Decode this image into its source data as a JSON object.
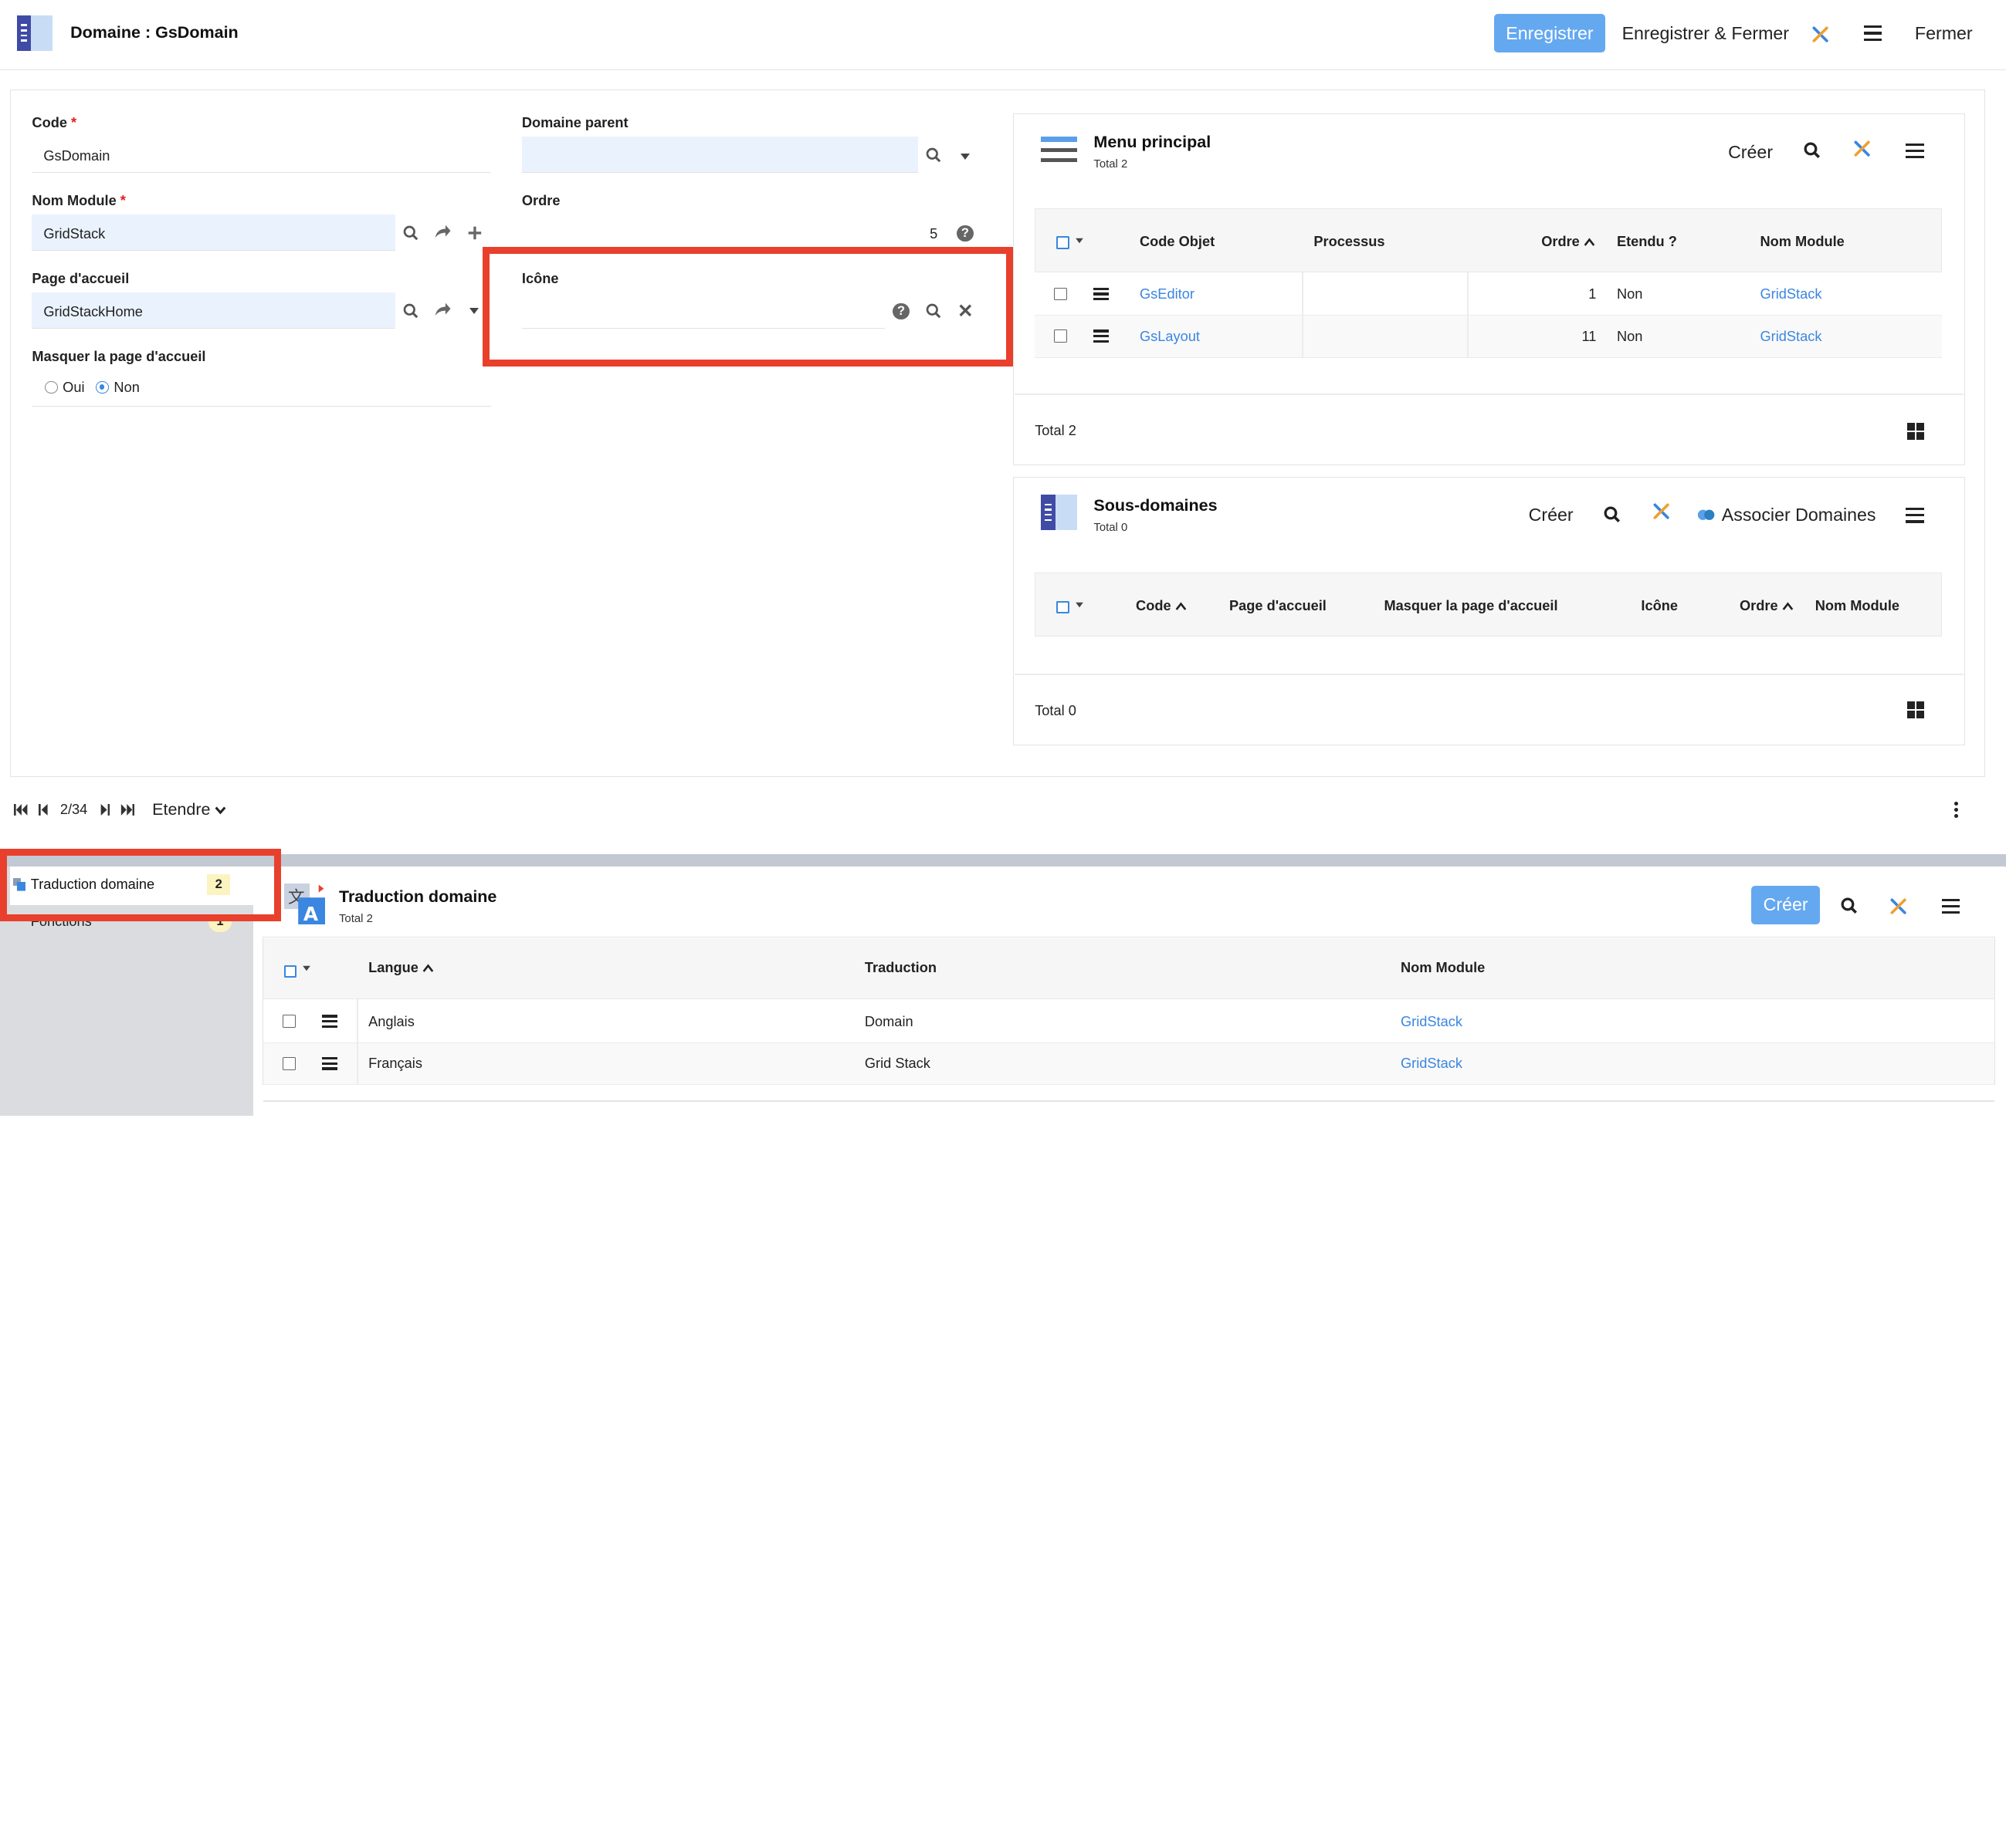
{
  "header": {
    "title": "Domaine : GsDomain",
    "save_label": "Enregistrer",
    "save_close_label": "Enregistrer & Fermer",
    "close_label": "Fermer"
  },
  "form": {
    "code_label": "Code",
    "code_value": "GsDomain",
    "module_label": "Nom Module",
    "module_value": "GridStack",
    "home_label": "Page d'accueil",
    "home_value": "GridStackHome",
    "hide_home_label": "Masquer la page d'accueil",
    "radio_oui": "Oui",
    "radio_non": "Non",
    "parent_label": "Domaine parent",
    "parent_value": "",
    "order_label": "Ordre",
    "order_value": "5",
    "icon_label": "Icône",
    "icon_value": "",
    "required_mark": "*"
  },
  "menu_card": {
    "title": "Menu principal",
    "total": "Total 2",
    "create_label": "Créer",
    "columns": [
      "Code Objet",
      "Processus",
      "Ordre",
      "Etendu ?",
      "Nom Module"
    ],
    "rows": [
      {
        "code": "GsEditor",
        "processus": "",
        "ordre": "1",
        "etendu": "Non",
        "module": "GridStack"
      },
      {
        "code": "GsLayout",
        "processus": "",
        "ordre": "11",
        "etendu": "Non",
        "module": "GridStack"
      }
    ],
    "footer_total": "Total 2"
  },
  "sub_card": {
    "title": "Sous-domaines",
    "total": "Total 0",
    "create_label": "Créer",
    "associate_label": "Associer Domaines",
    "columns": [
      "Code",
      "Page d'accueil",
      "Masquer la page d'accueil",
      "Icône",
      "Ordre",
      "Nom Module"
    ],
    "footer_total": "Total 0"
  },
  "pager": {
    "position": "2/34",
    "extend_label": "Etendre"
  },
  "bottom": {
    "tab_label": "Traduction domaine",
    "tab_count": "2",
    "tab2_label": "Fonctions",
    "tab2_count": "1",
    "panel_title": "Traduction domaine",
    "panel_total": "Total 2",
    "create_label": "Créer",
    "columns": [
      "Langue",
      "Traduction",
      "Nom Module"
    ],
    "rows": [
      {
        "langue": "Anglais",
        "traduction": "Domain",
        "module": "GridStack"
      },
      {
        "langue": "Français",
        "traduction": "Grid Stack",
        "module": "GridStack"
      }
    ]
  },
  "colors": {
    "accent": "#64a8f0",
    "link": "#3a86e0",
    "highlight": "#e8402c",
    "field_fill": "#eaf3fd"
  },
  "icons": [
    "domain-icon",
    "search-icon",
    "share-icon",
    "plus-icon",
    "help-icon",
    "close-icon",
    "tools-icon",
    "menu-icon",
    "grid-icon",
    "translate-icon",
    "first-page-icon",
    "prev-page-icon",
    "next-page-icon",
    "last-page-icon",
    "more-vertical-icon"
  ]
}
